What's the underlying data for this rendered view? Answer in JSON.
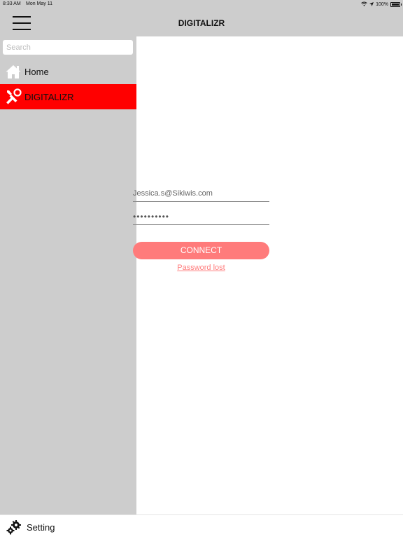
{
  "status_bar": {
    "time": "8:33 AM",
    "date": "Mon May 11",
    "battery": "100%"
  },
  "navbar": {
    "title": "DIGITALIZR",
    "menu_icon": "hamburger-icon"
  },
  "sidebar": {
    "search_placeholder": "Search",
    "items": [
      {
        "label": "Home",
        "icon": "home-icon",
        "selected": false
      },
      {
        "label": "DIGITALIZR",
        "icon": "tools-icon",
        "selected": true
      }
    ],
    "footer": {
      "label": "Setting",
      "icon": "gears-icon"
    }
  },
  "login": {
    "email_value": "Jessica.s@Sikiwis.com",
    "password_value": "••••••••••",
    "connect_label": "CONNECT",
    "password_lost_label": "Password lost"
  },
  "colors": {
    "bar_gray": "#cdcdcd",
    "selected_red": "#ff0000",
    "accent_pink": "#ff7b7b"
  }
}
